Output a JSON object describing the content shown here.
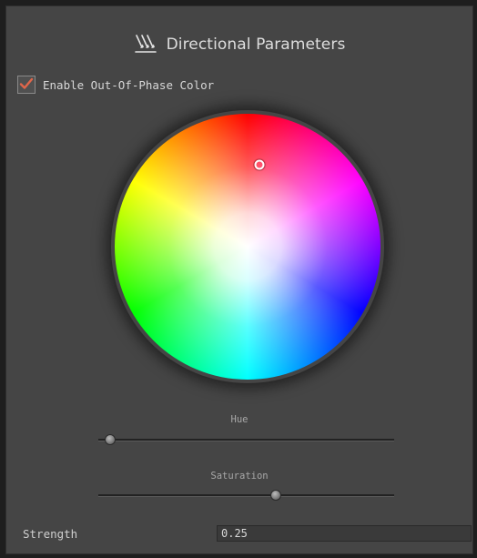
{
  "panel": {
    "title": "Directional Parameters",
    "title_icon": "directional-arrows-icon"
  },
  "enable": {
    "label": "Enable Out-Of-Phase Color",
    "checked": true,
    "check_color": "#e0664a"
  },
  "color_wheel": {
    "hue_deg": 8,
    "saturation_fraction": 0.62
  },
  "sliders": {
    "hue": {
      "label": "Hue",
      "value_fraction": 0.04
    },
    "saturation": {
      "label": "Saturation",
      "value_fraction": 0.6
    }
  },
  "strength": {
    "label": "Strength",
    "value": "0.25"
  }
}
